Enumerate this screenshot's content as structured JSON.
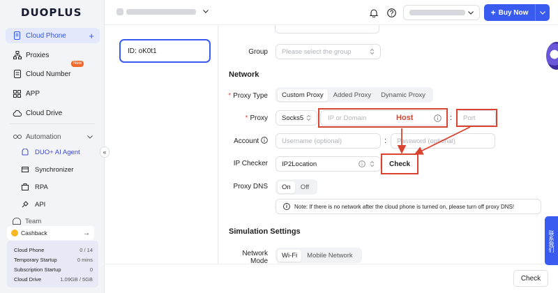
{
  "app": {
    "logo_text": "DUOPLUS"
  },
  "sidebar": {
    "items": [
      {
        "label": "Cloud Phone",
        "icon": "cloud-phone-icon"
      },
      {
        "label": "Proxies",
        "icon": "proxies-icon"
      },
      {
        "label": "Cloud Number",
        "icon": "cloud-number-icon",
        "badge": "New"
      },
      {
        "label": "APP",
        "icon": "app-grid-icon"
      },
      {
        "label": "Cloud Drive",
        "icon": "cloud-drive-icon"
      }
    ],
    "add_symbol": "+",
    "automation": {
      "label": "Automation",
      "items": [
        {
          "label": "DUO+ AI Agent"
        },
        {
          "label": "Synchronizer"
        },
        {
          "label": "RPA"
        },
        {
          "label": "API"
        }
      ]
    },
    "team_label": "Team",
    "collapse_symbol": "«",
    "cashback": {
      "label": "Cashback",
      "arrow": "→"
    },
    "usage": [
      {
        "label": "Cloud Phone",
        "value": "0 / 14"
      },
      {
        "label": "Temporary Startup",
        "value": "0 mins"
      },
      {
        "label": "Subscription Startup",
        "value": "0"
      },
      {
        "label": "Cloud Drive",
        "value": "1.09GB / 5GB"
      }
    ]
  },
  "topbar": {
    "buy_label": "Buy Now",
    "buy_plus": "+"
  },
  "device": {
    "id_label": "ID: oK0t1"
  },
  "form": {
    "group": {
      "label": "Group",
      "placeholder": "Please select the group"
    },
    "network_heading": "Network",
    "proxy_type": {
      "required_mark": "*",
      "label": "Proxy Type",
      "options": [
        "Custom Proxy",
        "Added Proxy",
        "Dynamic Proxy"
      ],
      "selected": "Custom Proxy"
    },
    "proxy": {
      "required_mark": "*",
      "label": "Proxy",
      "protocol": "Socks5",
      "host_placeholder": "IP or Domain",
      "separator": ":",
      "port_placeholder": "Port"
    },
    "account": {
      "label": "Account",
      "username_placeholder": "Username (optional)",
      "separator": ":",
      "password_placeholder": "Password (optional)"
    },
    "ip_checker": {
      "label": "IP Checker",
      "value": "IP2Location",
      "check_label": "Check"
    },
    "proxy_dns": {
      "label": "Proxy DNS",
      "options": [
        "On",
        "Off"
      ],
      "selected": "On",
      "note": "Note: If there is no network after the cloud phone is turned on, please turn off proxy DNS!"
    },
    "simulation_heading": "Simulation Settings",
    "network_mode": {
      "label_line1": "Network",
      "label_line2": "Mode",
      "options": [
        "Wi-Fi",
        "Mobile Network"
      ],
      "selected": "Wi-Fi"
    }
  },
  "annotations": {
    "host_label": "Host",
    "color": "#d9432f"
  },
  "footer": {
    "check_label": "Check"
  },
  "floating": {
    "contact_label": "联系我们"
  },
  "colors": {
    "accent": "#3a5bef",
    "annotation": "#d9432f",
    "required": "#e84141"
  }
}
